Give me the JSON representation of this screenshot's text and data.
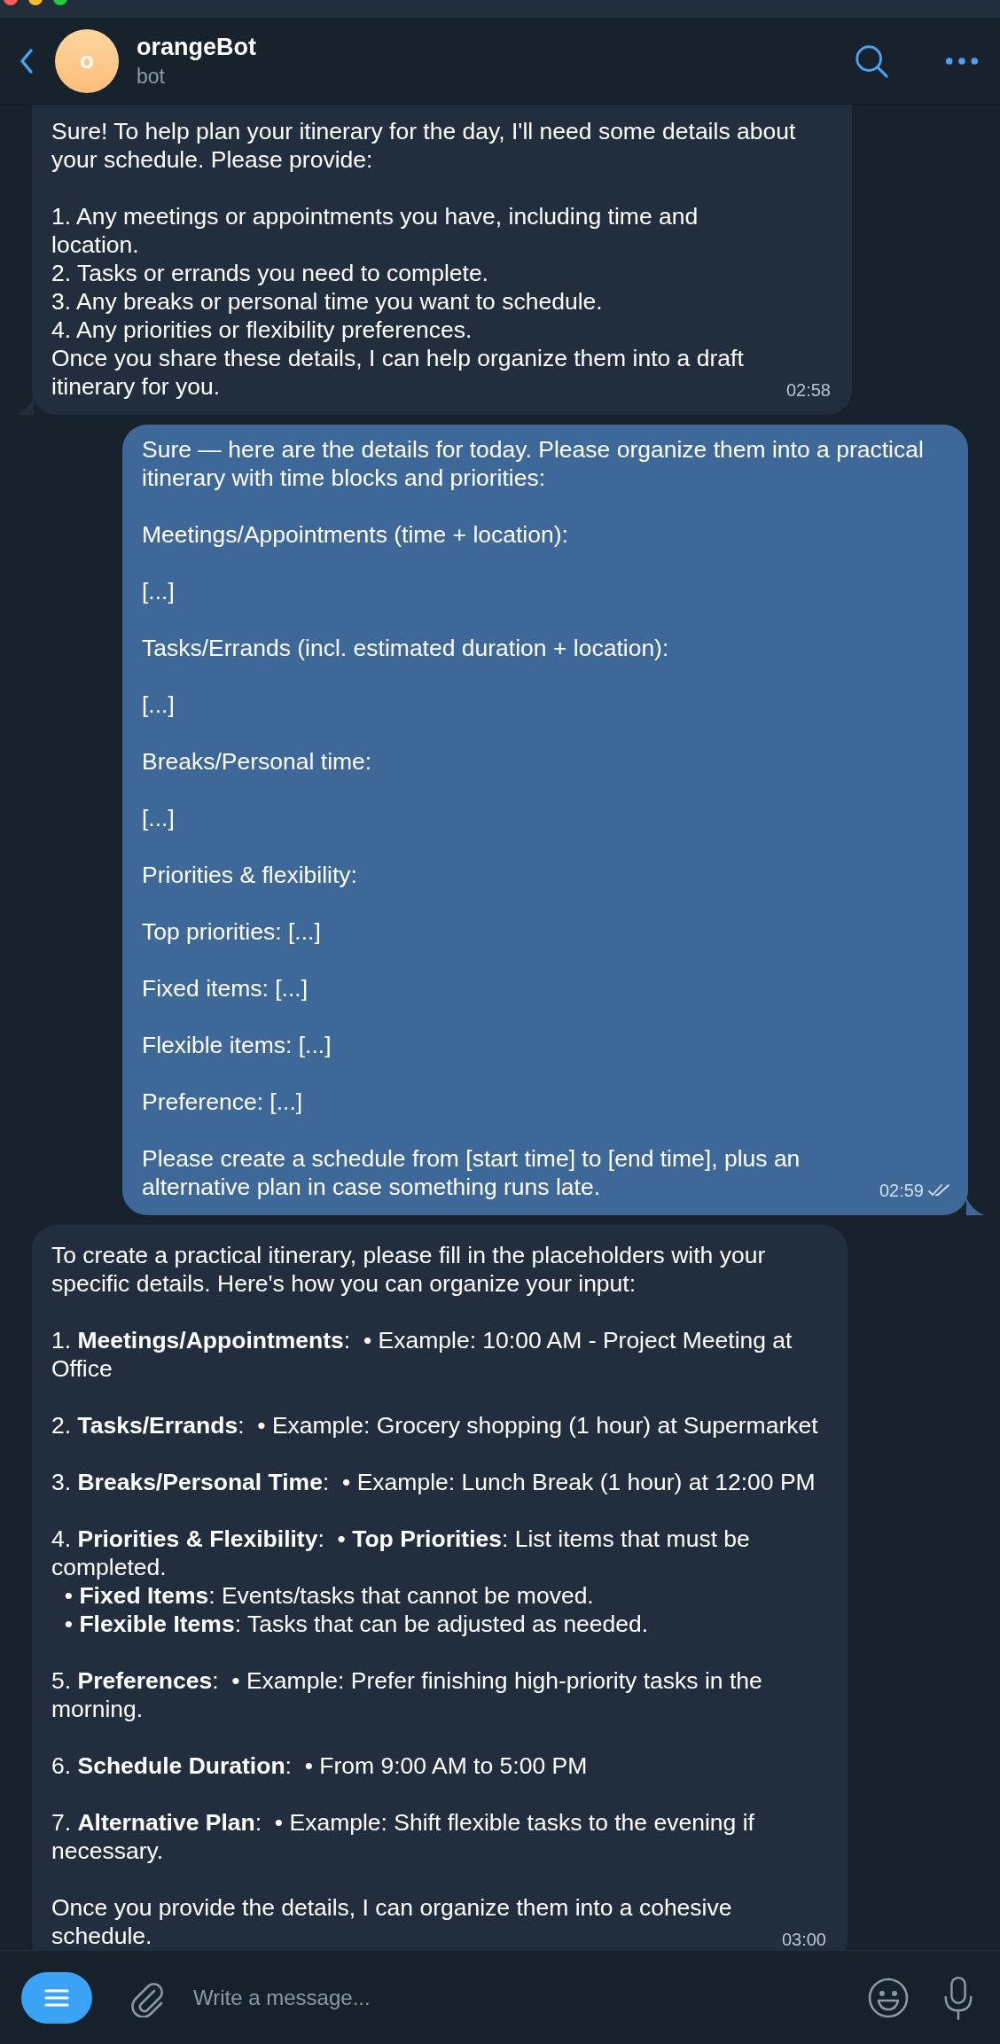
{
  "window": {
    "controls": [
      {
        "kind": "close"
      },
      {
        "kind": "minimize"
      },
      {
        "kind": "zoom"
      }
    ]
  },
  "header": {
    "avatar_letter": "o",
    "title": "orangeBot",
    "subtitle": "bot"
  },
  "messages": [
    {
      "kind": "incoming",
      "time": "02:58",
      "paragraphs": [
        [
          "Sure! To help plan your itinerary for the day, I'll need some details about your schedule. Please provide:"
        ],
        [
          "1. Any meetings or appointments you have, including time and location.",
          "2. Tasks or errands you need to complete.",
          "3. Any breaks or personal time you want to schedule.",
          "4. Any priorities or flexibility preferences.",
          "Once you share these details, I can help organize them into a draft itinerary for you."
        ]
      ]
    },
    {
      "kind": "outgoing",
      "time": "02:59",
      "read": true,
      "paragraphs": [
        [
          "Sure — here are the details for today. Please organize them into a practical itinerary with time blocks and priorities:"
        ],
        [
          "Meetings/Appointments (time + location):"
        ],
        [
          "[...]"
        ],
        [
          "Tasks/Errands (incl. estimated duration + location):"
        ],
        [
          "[...]"
        ],
        [
          "Breaks/Personal time:"
        ],
        [
          "[...]"
        ],
        [
          "Priorities & flexibility:"
        ],
        [
          "Top priorities: [...]"
        ],
        [
          "Fixed items: [...]"
        ],
        [
          "Flexible items: [...]"
        ],
        [
          "Preference: [...]"
        ],
        [
          "Please create a schedule from [start time] to [end time], plus an alternative plan in case something runs late."
        ]
      ]
    },
    {
      "kind": "incoming",
      "time": "03:00",
      "paragraphs": [
        [
          "To create a practical itinerary, please fill in the placeholders with your specific details. Here's how you can organize your input:"
        ],
        [
          "1. **Meetings/Appointments**:  • Example: 10:00 AM - Project Meeting at Office"
        ],
        [
          "2. **Tasks/Errands**:  • Example: Grocery shopping (1 hour) at Supermarket"
        ],
        [
          "3. **Breaks/Personal Time**:  • Example: Lunch Break (1 hour) at 12:00 PM"
        ],
        [
          "4. **Priorities & Flexibility**:  • **Top Priorities**: List items that must be completed.",
          "  • **Fixed Items**: Events/tasks that cannot be moved.",
          "  • **Flexible Items**: Tasks that can be adjusted as needed."
        ],
        [
          "5. **Preferences**:  • Example: Prefer finishing high-priority tasks in the morning."
        ],
        [
          "6. **Schedule Duration**:  • From 9:00 AM to 5:00 PM"
        ],
        [
          "7. **Alternative Plan**:  • Example: Shift flexible tasks to the evening if necessary."
        ],
        [
          "Once you provide the details, I can organize them into a cohesive schedule."
        ]
      ]
    }
  ],
  "composer": {
    "placeholder": "Write a message..."
  }
}
